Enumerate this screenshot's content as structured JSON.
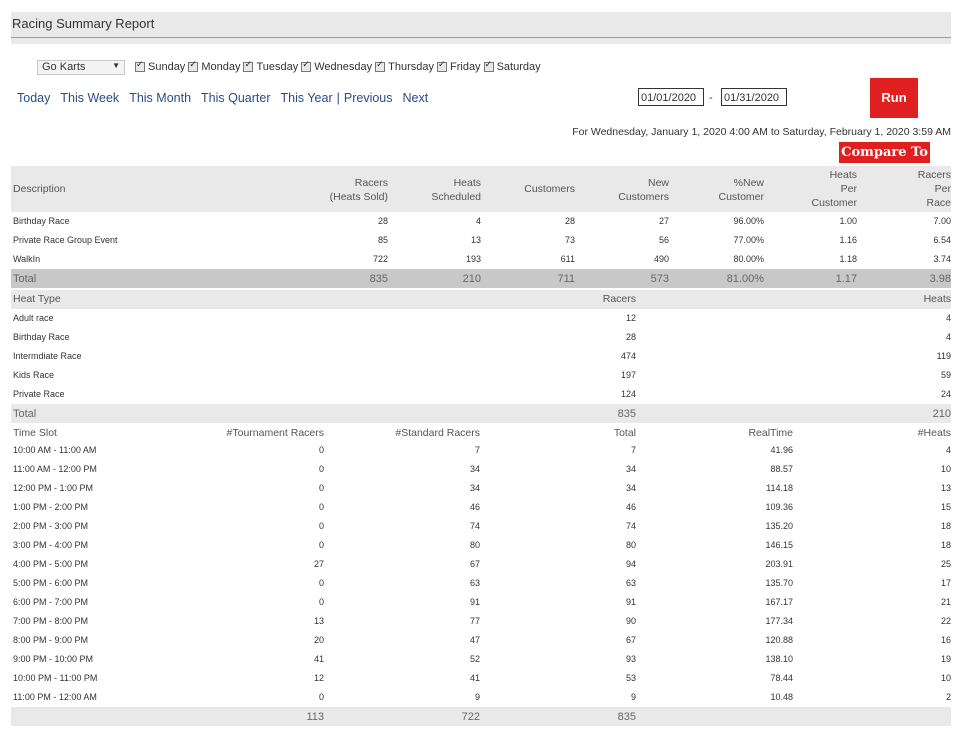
{
  "title": "Racing Summary Report",
  "track": "Go Karts",
  "days": [
    "Sunday",
    "Monday",
    "Tuesday",
    "Wednesday",
    "Thursday",
    "Friday",
    "Saturday"
  ],
  "nav": {
    "today": "Today",
    "week": "This Week",
    "month": "This Month",
    "quarter": "This Quarter",
    "year": "This Year",
    "sep": "|",
    "previous": "Previous",
    "next": "Next"
  },
  "start_date": "01/01/2020",
  "end_date": "01/31/2020",
  "dash": "-",
  "run_label": "Run",
  "range_text": "For Wednesday, January 1, 2020 4:00 AM to Saturday, February 1, 2020 3:59 AM",
  "compare_label": "Compare To",
  "summary": {
    "headers": {
      "description": "Description",
      "racers": [
        "Racers",
        "(Heats Sold)"
      ],
      "heats": [
        "Heats",
        "Scheduled"
      ],
      "customers": "Customers",
      "new": [
        "New",
        "Customers"
      ],
      "pct": [
        "%New",
        "Customer"
      ],
      "hpc": [
        "Heats",
        "Per",
        "Customer"
      ],
      "rpr": [
        "Racers",
        "Per",
        "Race"
      ]
    },
    "rows": [
      [
        "Birthday Race",
        "28",
        "4",
        "28",
        "27",
        "96.00%",
        "1.00",
        "7.00"
      ],
      [
        "Private Race Group Event",
        "85",
        "13",
        "73",
        "56",
        "77.00%",
        "1.16",
        "6.54"
      ],
      [
        "WalkIn",
        "722",
        "193",
        "611",
        "490",
        "80.00%",
        "1.18",
        "3.74"
      ]
    ],
    "total": [
      "Total",
      "835",
      "210",
      "711",
      "573",
      "81.00%",
      "1.17",
      "3.98"
    ]
  },
  "heat_types": {
    "headers": [
      "Heat Type",
      "Racers",
      "Heats"
    ],
    "rows": [
      [
        "Adult race",
        "12",
        "4"
      ],
      [
        "Birthday Race",
        "28",
        "4"
      ],
      [
        "Intermdiate Race",
        "474",
        "119"
      ],
      [
        "Kids Race",
        "197",
        "59"
      ],
      [
        "Private Race",
        "124",
        "24"
      ]
    ],
    "total": [
      "Total",
      "835",
      "210"
    ]
  },
  "time_slots": {
    "headers": [
      "Time Slot",
      "#Tournament Racers",
      "#Standard Racers",
      "Total",
      "RealTime",
      "#Heats"
    ],
    "rows": [
      [
        "10:00 AM - 11:00 AM",
        "0",
        "7",
        "7",
        "41.96",
        "4"
      ],
      [
        "11:00 AM - 12:00 PM",
        "0",
        "34",
        "34",
        "88.57",
        "10"
      ],
      [
        "12:00 PM - 1:00 PM",
        "0",
        "34",
        "34",
        "114.18",
        "13"
      ],
      [
        "1:00 PM - 2:00 PM",
        "0",
        "46",
        "46",
        "109.36",
        "15"
      ],
      [
        "2:00 PM - 3:00 PM",
        "0",
        "74",
        "74",
        "135.20",
        "18"
      ],
      [
        "3:00 PM - 4:00 PM",
        "0",
        "80",
        "80",
        "146.15",
        "18"
      ],
      [
        "4:00 PM - 5:00 PM",
        "27",
        "67",
        "94",
        "203.91",
        "25"
      ],
      [
        "5:00 PM - 6:00 PM",
        "0",
        "63",
        "63",
        "135.70",
        "17"
      ],
      [
        "6:00 PM - 7:00 PM",
        "0",
        "91",
        "91",
        "167.17",
        "21"
      ],
      [
        "7:00 PM - 8:00 PM",
        "13",
        "77",
        "90",
        "177.34",
        "22"
      ],
      [
        "8:00 PM - 9:00 PM",
        "20",
        "47",
        "67",
        "120.88",
        "16"
      ],
      [
        "9:00 PM - 10:00 PM",
        "41",
        "52",
        "93",
        "138.10",
        "19"
      ],
      [
        "10:00 PM - 11:00 PM",
        "12",
        "41",
        "53",
        "78.44",
        "10"
      ],
      [
        "11:00 PM - 12:00 AM",
        "0",
        "9",
        "9",
        "10.48",
        "2"
      ]
    ],
    "total": [
      "",
      "113",
      "722",
      "835",
      "",
      ""
    ]
  }
}
